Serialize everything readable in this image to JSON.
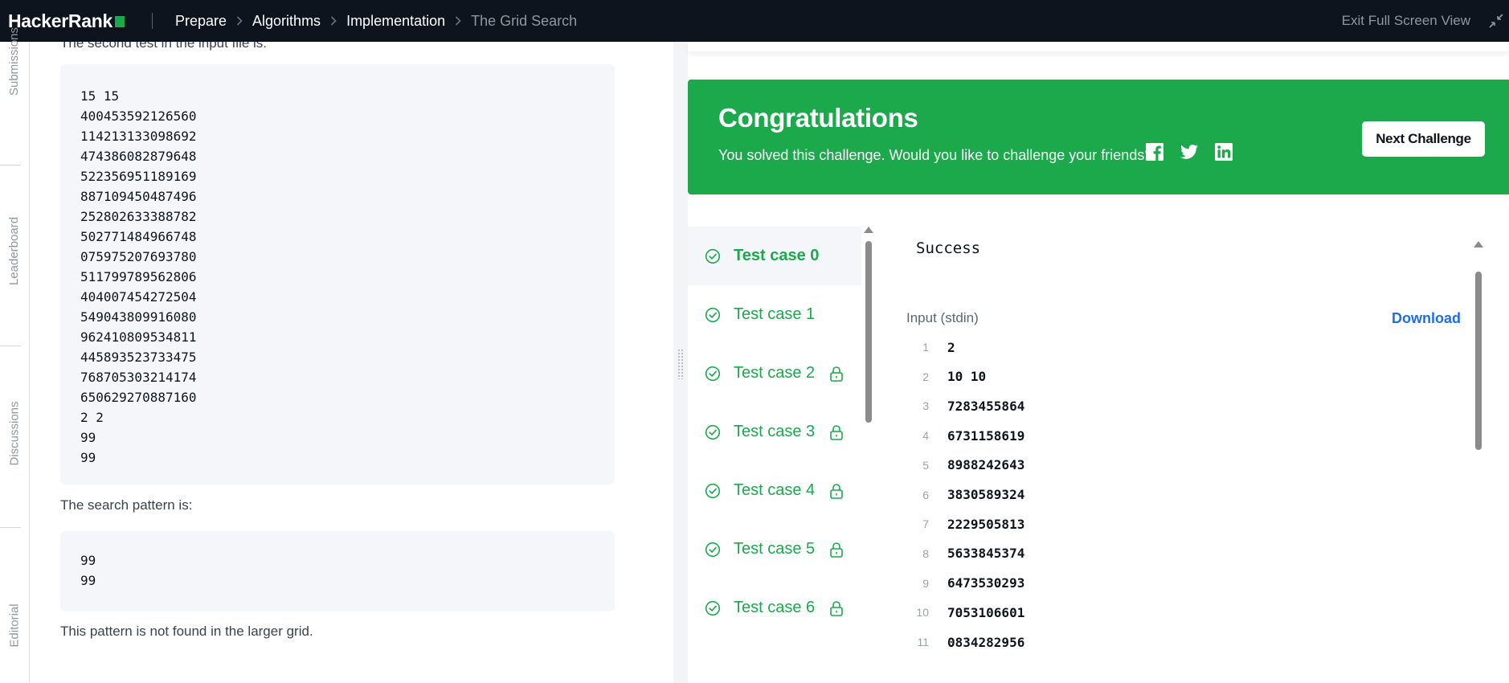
{
  "nav": {
    "logo": "HackerRank",
    "breadcrumbs": [
      "Prepare",
      "Algorithms",
      "Implementation",
      "The Grid Search"
    ],
    "exit_fullscreen": "Exit Full Screen View"
  },
  "sidebar_tabs": [
    "Submissions",
    "Leaderboard",
    "Discussions",
    "Editorial"
  ],
  "description": {
    "cutoff_text": "The second test in the input file is:",
    "input_block": [
      "15 15",
      "400453592126560",
      "114213133098692",
      "474386082879648",
      "522356951189169",
      "887109450487496",
      "252802633388782",
      "502771484966748",
      "075975207693780",
      "511799789562806",
      "404007454272504",
      "549043809916080",
      "962410809534811",
      "445893523733475",
      "768705303214174",
      "650629270887160",
      "2 2",
      "99",
      "99"
    ],
    "pattern_intro": "The search pattern is:",
    "pattern_block": [
      "99",
      "99"
    ],
    "pattern_result": "This pattern is not found in the larger grid."
  },
  "banner": {
    "title": "Congratulations",
    "subtitle": "You solved this challenge. Would you like to challenge your friends?",
    "next_button": "Next Challenge",
    "color": "#1ba94c"
  },
  "test_cases": [
    {
      "label": "Test case 0",
      "locked": false,
      "active": true
    },
    {
      "label": "Test case 1",
      "locked": false,
      "active": false
    },
    {
      "label": "Test case 2",
      "locked": true,
      "active": false
    },
    {
      "label": "Test case 3",
      "locked": true,
      "active": false
    },
    {
      "label": "Test case 4",
      "locked": true,
      "active": false
    },
    {
      "label": "Test case 5",
      "locked": true,
      "active": false
    },
    {
      "label": "Test case 6",
      "locked": true,
      "active": false
    }
  ],
  "output": {
    "status": "Success",
    "input_label": "Input (stdin)",
    "download": "Download",
    "lines": [
      {
        "n": "1",
        "v": "2"
      },
      {
        "n": "2",
        "v": "10 10"
      },
      {
        "n": "3",
        "v": "7283455864"
      },
      {
        "n": "4",
        "v": "6731158619"
      },
      {
        "n": "5",
        "v": "8988242643"
      },
      {
        "n": "6",
        "v": "3830589324"
      },
      {
        "n": "7",
        "v": "2229505813"
      },
      {
        "n": "8",
        "v": "5633845374"
      },
      {
        "n": "9",
        "v": "6473530293"
      },
      {
        "n": "10",
        "v": "7053106601"
      },
      {
        "n": "11",
        "v": "0834282956"
      }
    ]
  },
  "colors": {
    "nav_bg": "#0e141e",
    "success_green": "#1ba94c",
    "link_blue": "#1f6ee8",
    "code_bg": "#f5f6fa"
  }
}
